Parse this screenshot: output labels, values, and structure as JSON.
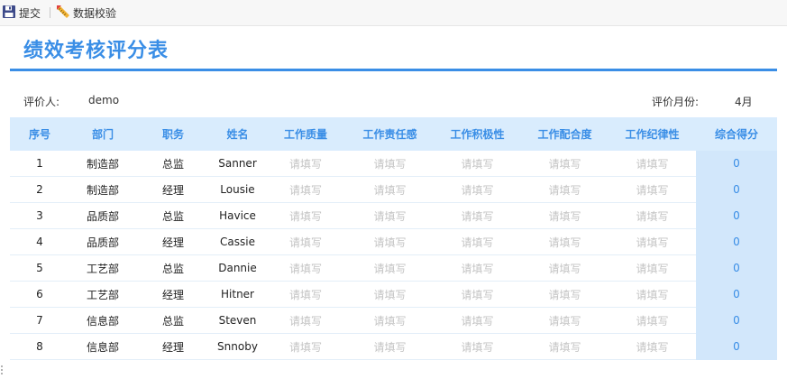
{
  "toolbar": {
    "submit_label": "提交",
    "validate_label": "数据校验"
  },
  "form_title": "绩效考核评分表",
  "meta": {
    "evaluator_label": "评价人:",
    "evaluator_value": "demo",
    "month_label": "评价月份:",
    "month_value": "4月"
  },
  "table": {
    "headers": [
      "序号",
      "部门",
      "职务",
      "姓名",
      "工作质量",
      "工作责任感",
      "工作积极性",
      "工作配合度",
      "工作纪律性",
      "综合得分"
    ],
    "placeholder": "请填写",
    "rows": [
      {
        "no": "1",
        "dept": "制造部",
        "role": "总监",
        "name": "Sanner",
        "score": "0"
      },
      {
        "no": "2",
        "dept": "制造部",
        "role": "经理",
        "name": "Lousie",
        "score": "0"
      },
      {
        "no": "3",
        "dept": "品质部",
        "role": "总监",
        "name": "Havice",
        "score": "0"
      },
      {
        "no": "4",
        "dept": "品质部",
        "role": "经理",
        "name": "Cassie",
        "score": "0"
      },
      {
        "no": "5",
        "dept": "工艺部",
        "role": "总监",
        "name": "Dannie",
        "score": "0"
      },
      {
        "no": "6",
        "dept": "工艺部",
        "role": "经理",
        "name": "Hitner",
        "score": "0"
      },
      {
        "no": "7",
        "dept": "信息部",
        "role": "总监",
        "name": "Steven",
        "score": "0"
      },
      {
        "no": "8",
        "dept": "信息部",
        "role": "经理",
        "name": "Snnoby",
        "score": "0"
      }
    ]
  },
  "icons": {
    "submit": "floppy-disk-icon",
    "validate": "ruler-pencil-icon"
  },
  "colors": {
    "accent": "#3a8ee6",
    "header_bg": "#d9ecfd",
    "score_bg": "#d2e7fb",
    "placeholder": "#c3c3c3"
  }
}
